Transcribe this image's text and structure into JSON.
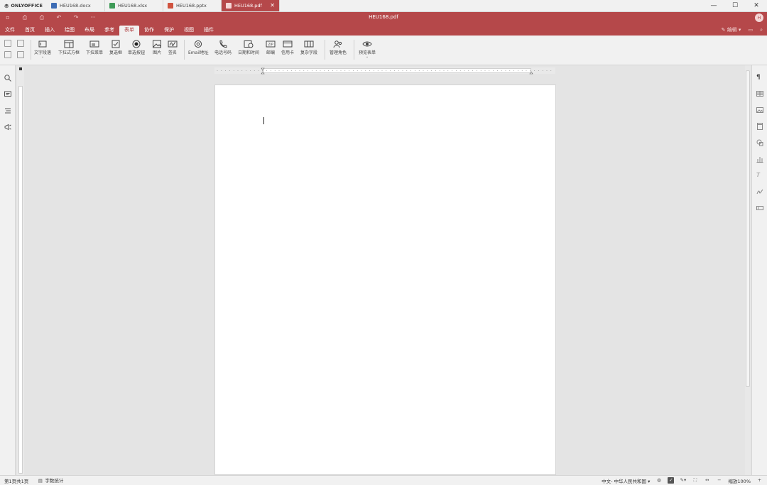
{
  "app": {
    "logo_text": "ONLYOFFICE",
    "tabs": [
      {
        "label": "HEU168.docx",
        "kind": "docx",
        "color": "#3e6db5"
      },
      {
        "label": "HEU168.xlsx",
        "kind": "xlsx",
        "color": "#3f9b58"
      },
      {
        "label": "HEU168.pptx",
        "kind": "pptx",
        "color": "#d0533f"
      },
      {
        "label": "HEU168.pdf",
        "kind": "pdf",
        "color": "#b5484a",
        "active": true
      }
    ]
  },
  "header": {
    "title": "HEU168.pdf",
    "avatar_initial": "H"
  },
  "menu": {
    "items": [
      "文件",
      "首页",
      "插入",
      "绘图",
      "布局",
      "参考",
      "表单",
      "协作",
      "保护",
      "视图",
      "插件"
    ],
    "active_index": 6,
    "edit_label": "编辑"
  },
  "toolbar": {
    "buttons": [
      {
        "label": "文字段落",
        "icon": "text-field-icon",
        "caret": true
      },
      {
        "label": "下拉式方框",
        "icon": "combo-box-icon"
      },
      {
        "label": "下拉菜单",
        "icon": "dropdown-icon"
      },
      {
        "label": "复选框",
        "icon": "checkbox-icon"
      },
      {
        "label": "单选按钮",
        "icon": "radio-icon"
      },
      {
        "label": "图片",
        "icon": "image-icon"
      },
      {
        "label": "签名",
        "icon": "signature-icon"
      },
      {
        "label": "Email地址",
        "icon": "email-icon"
      },
      {
        "label": "电话号码",
        "icon": "phone-icon"
      },
      {
        "label": "日期和时间",
        "icon": "datetime-icon"
      },
      {
        "label": "邮编",
        "icon": "zip-icon"
      },
      {
        "label": "信用卡",
        "icon": "credit-card-icon"
      },
      {
        "label": "复杂字段",
        "icon": "complex-field-icon"
      },
      {
        "label": "管理角色",
        "icon": "manage-roles-icon"
      },
      {
        "label": "预览表单",
        "icon": "preview-icon",
        "caret": true
      }
    ]
  },
  "statusbar": {
    "page_info": "第1页共1页",
    "word_count": "字数统计",
    "language": "中文- 中华人民共和国",
    "zoom": "缩放100%"
  },
  "colors": {
    "accent": "#b5484a",
    "panel": "#f1f1f1",
    "workspace": "#e4e4e4"
  }
}
